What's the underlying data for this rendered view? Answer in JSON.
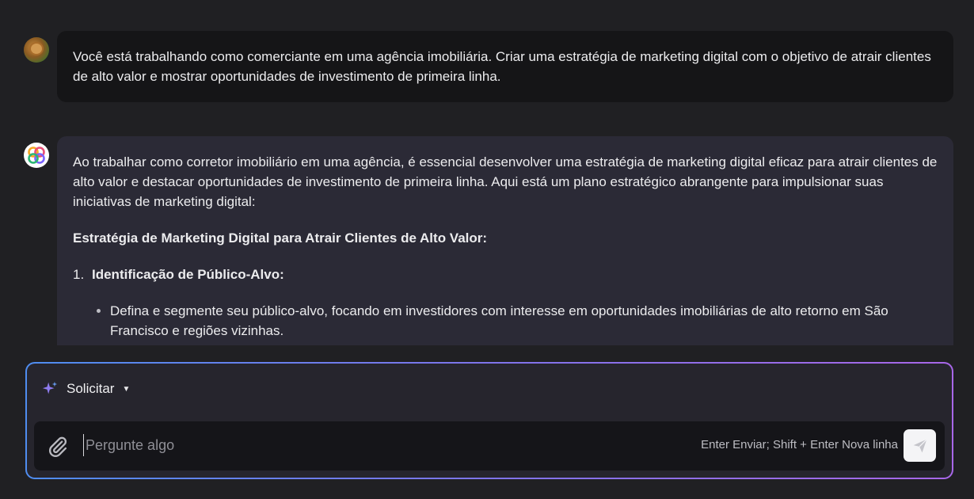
{
  "conversation": {
    "user_message": "Você está trabalhando como comerciante em uma agência imobiliária. Criar uma estratégia de marketing digital com o objetivo de atrair clientes de alto valor e mostrar oportunidades de investimento de primeira linha.",
    "assistant": {
      "intro": "Ao trabalhar como corretor imobiliário em uma agência, é essencial desenvolver uma estratégia de marketing digital eficaz para atrair clientes de alto valor e destacar oportunidades de investimento de primeira linha. Aqui está um plano estratégico abrangente para impulsionar suas iniciativas de marketing digital:",
      "heading": "Estratégia de Marketing Digital para Atrair Clientes de Alto Valor:",
      "items": [
        {
          "number": "1.",
          "title": "Identificação de Público-Alvo:",
          "bullets": [
            "Defina e segmente seu público-alvo, focando em investidores com interesse em oportunidades imobiliárias de alto retorno em São Francisco e regiões vizinhas."
          ]
        }
      ]
    }
  },
  "composer": {
    "mode_label": "Solicitar",
    "placeholder": "Pergunte algo",
    "hint": "Enter Enviar; Shift + Enter Nova linha",
    "gradient_colors": [
      "#4f8df0",
      "#7f74ea",
      "#a867e8"
    ]
  },
  "icons": {
    "user_avatar": "avatar-photo",
    "assistant_avatar": "multicolor-flower-logo",
    "mode": "sparkle-icon",
    "attach": "paperclip-icon",
    "send": "paper-plane-icon"
  }
}
